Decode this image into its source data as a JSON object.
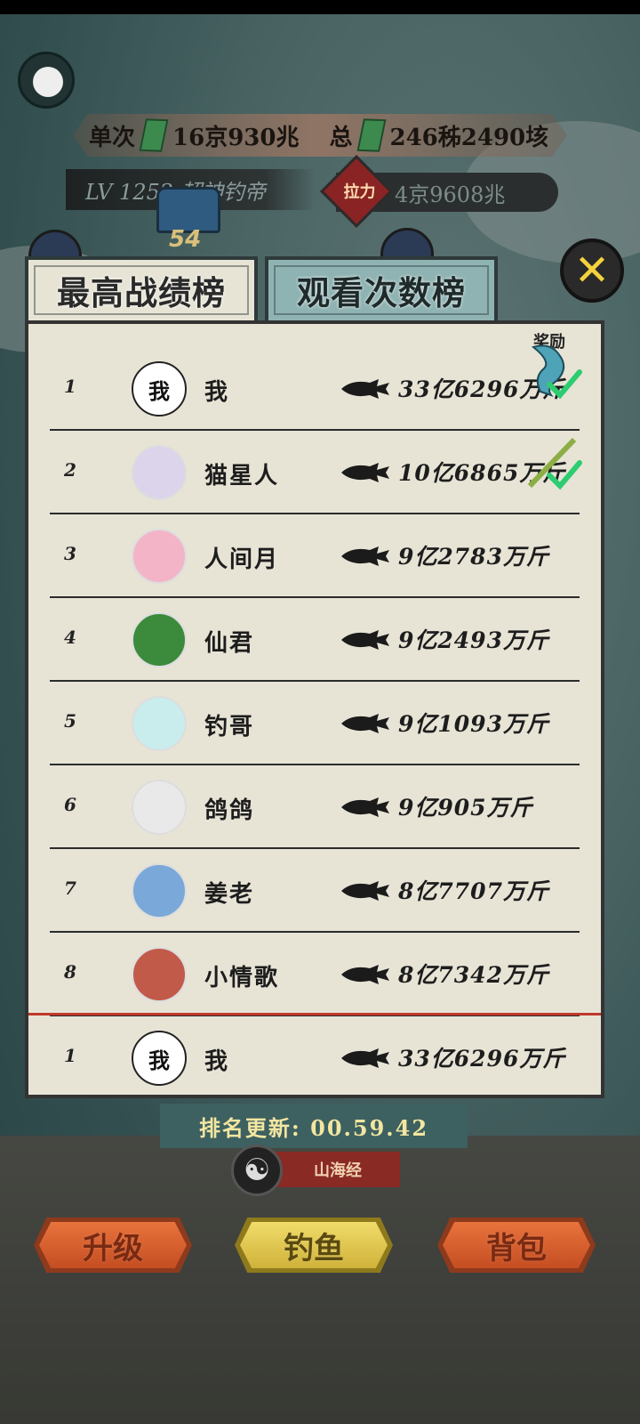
{
  "hud": {
    "single_label": "单次",
    "single_value": "16京930兆",
    "total_label": "总",
    "total_value": "246秭2490垓",
    "level_text": "LV 1252 超神钓帝",
    "pull_badge": "拉力",
    "pull_value": "4京9608兆",
    "chest_count": "54"
  },
  "tabs": {
    "best_record": "最高战绩榜",
    "view_count": "观看次数榜"
  },
  "close_symbol": "✕",
  "leaderboard": {
    "reward_header": "奖励",
    "rows": [
      {
        "rank": "1",
        "avatar_text": "我",
        "name": "我",
        "weight": "33亿6296万斤"
      },
      {
        "rank": "2",
        "avatar_text": "",
        "name": "猫星人",
        "weight": "10亿6865万斤"
      },
      {
        "rank": "3",
        "avatar_text": "",
        "name": "人间月",
        "weight": "9亿2783万斤"
      },
      {
        "rank": "4",
        "avatar_text": "",
        "name": "仙君",
        "weight": "9亿2493万斤"
      },
      {
        "rank": "5",
        "avatar_text": "",
        "name": "钓哥",
        "weight": "9亿1093万斤"
      },
      {
        "rank": "6",
        "avatar_text": "",
        "name": "鸽鸽",
        "weight": "9亿905万斤"
      },
      {
        "rank": "7",
        "avatar_text": "",
        "name": "姜老",
        "weight": "8亿7707万斤"
      },
      {
        "rank": "8",
        "avatar_text": "",
        "name": "小情歌",
        "weight": "8亿7342万斤"
      }
    ],
    "self": {
      "rank": "1",
      "avatar_text": "我",
      "name": "我",
      "weight": "33亿6296万斤"
    }
  },
  "timer": {
    "text": "排名更新: 00.59.42"
  },
  "shanhaijing": {
    "label": "山海经"
  },
  "bottom_buttons": {
    "upgrade": "升级",
    "fish": "钓鱼",
    "bag": "背包"
  },
  "colors": {
    "panel": "#e7e4d6",
    "tab_inactive": "#8fb3b3",
    "accent_red": "#c0392b",
    "check_green": "#2ecc71"
  }
}
